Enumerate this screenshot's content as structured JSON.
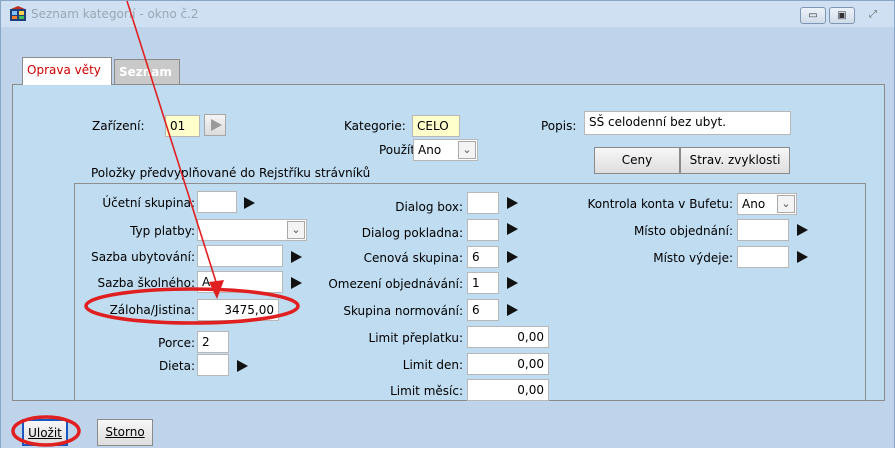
{
  "window": {
    "title": "Seznam kategorií - okno č.2",
    "controls": {
      "minimize": "▭",
      "maximize": "▣",
      "close": "⤢"
    }
  },
  "tabs": [
    {
      "label": "Oprava věty"
    },
    {
      "label": "Seznam"
    }
  ],
  "header": {
    "zarizeni": {
      "label": "Zařízení:",
      "value": "01"
    },
    "kategorie": {
      "label": "Kategorie:",
      "value": "CELO"
    },
    "popis": {
      "label": "Popis:",
      "value": "SŠ celodenní bez ubyt."
    },
    "pouzit": {
      "label": "Použít",
      "value": "Ano"
    },
    "ceny_label": "Ceny",
    "strav_label": "Strav. zvyklosti"
  },
  "group": {
    "title": "Položky předvyplňované do Rejstříku strávníků",
    "col1": {
      "ucetni_skupina": {
        "label": "Účetní skupina:",
        "value": ""
      },
      "typ_platby": {
        "label": "Typ platby:",
        "value": ""
      },
      "sazba_ubytovani": {
        "label": "Sazba ubytování:",
        "value": ""
      },
      "sazba_skolneho": {
        "label": "Sazba školného:",
        "value": "A"
      },
      "zaloha": {
        "label": "Záloha/Jistina:",
        "value": "3475,00"
      },
      "porce": {
        "label": "Porce:",
        "value": "2"
      },
      "dieta": {
        "label": "Dieta:",
        "value": ""
      }
    },
    "col2": {
      "dialog_box": {
        "label": "Dialog box:",
        "value": ""
      },
      "dialog_pokladna": {
        "label": "Dialog pokladna:",
        "value": ""
      },
      "cenova_skupina": {
        "label": "Cenová skupina:",
        "value": "6"
      },
      "omezeni_objednavani": {
        "label": "Omezení objednávání:",
        "value": "1"
      },
      "skupina_normovani": {
        "label": "Skupina normování:",
        "value": "6"
      },
      "limit_preplatku": {
        "label": "Limit přeplatku:",
        "value": "0,00"
      },
      "limit_den": {
        "label": "Limit den:",
        "value": "0,00"
      },
      "limit_mesic": {
        "label": "Limit měsíc:",
        "value": "0,00"
      }
    },
    "col3": {
      "kontrola_konta": {
        "label": "Kontrola konta v Bufetu:",
        "value": "Ano"
      },
      "misto_objednani": {
        "label": "Místo objednání:",
        "value": ""
      },
      "misto_vydeje": {
        "label": "Místo výdeje:",
        "value": ""
      }
    }
  },
  "footer": {
    "ulozit_label": "Uložit",
    "storno_label": "Storno"
  },
  "colors": {
    "window_bg": "#bfd4ea",
    "panel_bg": "#bfdcf0",
    "highlight_field": "#ffffcc",
    "annotation": "#e02020",
    "active_tab_text": "#cc0000"
  },
  "icons": {
    "app": "table-grid-icon",
    "lookup": "play-triangle-icon",
    "dropdown": "chevron-down-icon",
    "annotation": "red-arrow-and-ellipse"
  }
}
